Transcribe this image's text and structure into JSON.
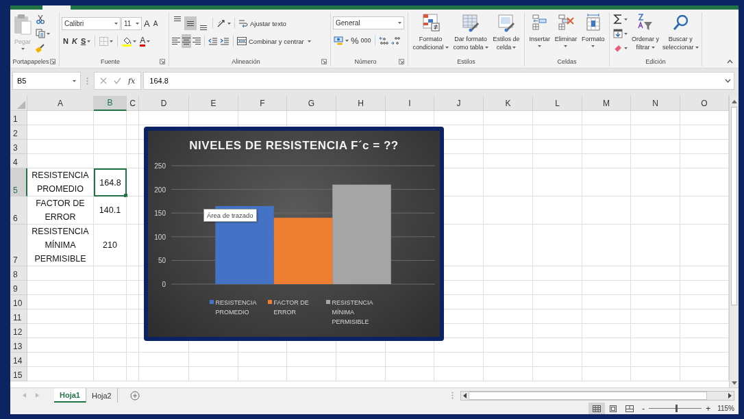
{
  "ribbon": {
    "groups": [
      {
        "kind": "clipboard",
        "label": "Portapapeles",
        "launcher": true,
        "paste": {
          "label": "Pegar",
          "disabled": true
        }
      },
      {
        "kind": "font",
        "label": "Fuente",
        "launcher": true,
        "font_name": "Calibri",
        "font_size": "11",
        "grow": "A",
        "shrink": "A",
        "bold": "N",
        "italic": "K",
        "underline": "S",
        "font_color": "A"
      },
      {
        "kind": "alignment",
        "label": "Alineación",
        "launcher": true,
        "vertical": [
          {
            "selected": false
          },
          {
            "selected": true
          },
          {
            "selected": false
          }
        ],
        "horizontal": [
          {
            "selected": false
          },
          {
            "selected": true
          },
          {
            "selected": false
          }
        ],
        "wrap_text": "Ajustar texto",
        "merge": "Combinar y centrar"
      },
      {
        "kind": "number",
        "label": "Número",
        "launcher": true,
        "format": "General",
        "percent": "%",
        "thousands": "000"
      },
      {
        "kind": "styles",
        "label": "Estilos",
        "buttons": [
          "Formato\ncondicional",
          "Dar formato\ncomo tabla",
          "Estilos de\ncelda"
        ]
      },
      {
        "kind": "cells",
        "label": "Celdas",
        "buttons": [
          "Insertar",
          "Eliminar",
          "Formato"
        ]
      },
      {
        "kind": "editing",
        "label": "Edición",
        "buttons": [
          "Ordenar y\nfiltrar",
          "Buscar y\nseleccionar"
        ]
      }
    ]
  },
  "formula_bar": {
    "name_box": "B5",
    "function_label": "fx",
    "value": "164.8"
  },
  "sheet": {
    "columns": [
      {
        "label": "A",
        "selected": false
      },
      {
        "label": "B",
        "selected": true
      },
      {
        "label": "C",
        "selected": false
      },
      {
        "label": "D",
        "selected": false
      },
      {
        "label": "E",
        "selected": false
      },
      {
        "label": "F",
        "selected": false
      },
      {
        "label": "G",
        "selected": false
      },
      {
        "label": "H",
        "selected": false
      },
      {
        "label": "I",
        "selected": false
      },
      {
        "label": "J",
        "selected": false
      },
      {
        "label": "K",
        "selected": false
      },
      {
        "label": "L",
        "selected": false
      },
      {
        "label": "M",
        "selected": false
      },
      {
        "label": "N",
        "selected": false
      },
      {
        "label": "O",
        "selected": false
      }
    ],
    "rows": [
      {
        "label": "1",
        "selected": false
      },
      {
        "label": "2",
        "selected": false
      },
      {
        "label": "3",
        "selected": false
      },
      {
        "label": "4",
        "selected": false
      },
      {
        "label": "5",
        "selected": true,
        "cells": [
          {
            "text": "RESISTENCIA PROMEDIO",
            "active": false
          },
          {
            "text": "164.8",
            "active": true
          }
        ]
      },
      {
        "label": "6",
        "selected": false,
        "cells": [
          {
            "text": "FACTOR DE ERROR",
            "active": false
          },
          {
            "text": "140.1",
            "active": false
          }
        ]
      },
      {
        "label": "7",
        "selected": false,
        "cells": [
          {
            "text": "RESISTENCIA MÍNIMA PERMISIBLE",
            "active": false
          },
          {
            "text": "210",
            "active": false
          }
        ]
      },
      {
        "label": "8",
        "selected": false
      },
      {
        "label": "9",
        "selected": false
      },
      {
        "label": "10",
        "selected": false
      },
      {
        "label": "11",
        "selected": false
      },
      {
        "label": "12",
        "selected": false
      },
      {
        "label": "13",
        "selected": false
      },
      {
        "label": "14",
        "selected": false
      },
      {
        "label": "15",
        "selected": false
      }
    ]
  },
  "chart": {
    "tooltip": "Área de trazado",
    "chart_data": {
      "type": "bar",
      "title": "NIVELES DE RESISTENCIA F´c = ??",
      "series": [
        {
          "name": "RESISTENCIA PROMEDIO",
          "color": "#4472c4",
          "values": [
            164.8
          ]
        },
        {
          "name": "FACTOR DE ERROR",
          "color": "#ed7d31",
          "values": [
            140.1
          ]
        },
        {
          "name": "RESISTENCIA MÍNIMA PERMISIBLE",
          "color": "#a5a5a5",
          "values": [
            210
          ]
        }
      ],
      "ylim": [
        0,
        250
      ],
      "yticks": [
        0,
        50,
        100,
        150,
        200,
        250
      ],
      "grid": true,
      "legend": "bottom"
    }
  },
  "sheet_tabs": [
    {
      "label": "Hoja1",
      "selected": true
    },
    {
      "label": "Hoja2",
      "selected": false
    }
  ],
  "status_bar": {
    "views": [
      {
        "selected": true
      },
      {
        "selected": false
      },
      {
        "selected": false
      }
    ],
    "zoom_out": "-",
    "zoom_in": "+",
    "zoom": {
      "level": 0.52
    },
    "zoom_label": "115%"
  }
}
